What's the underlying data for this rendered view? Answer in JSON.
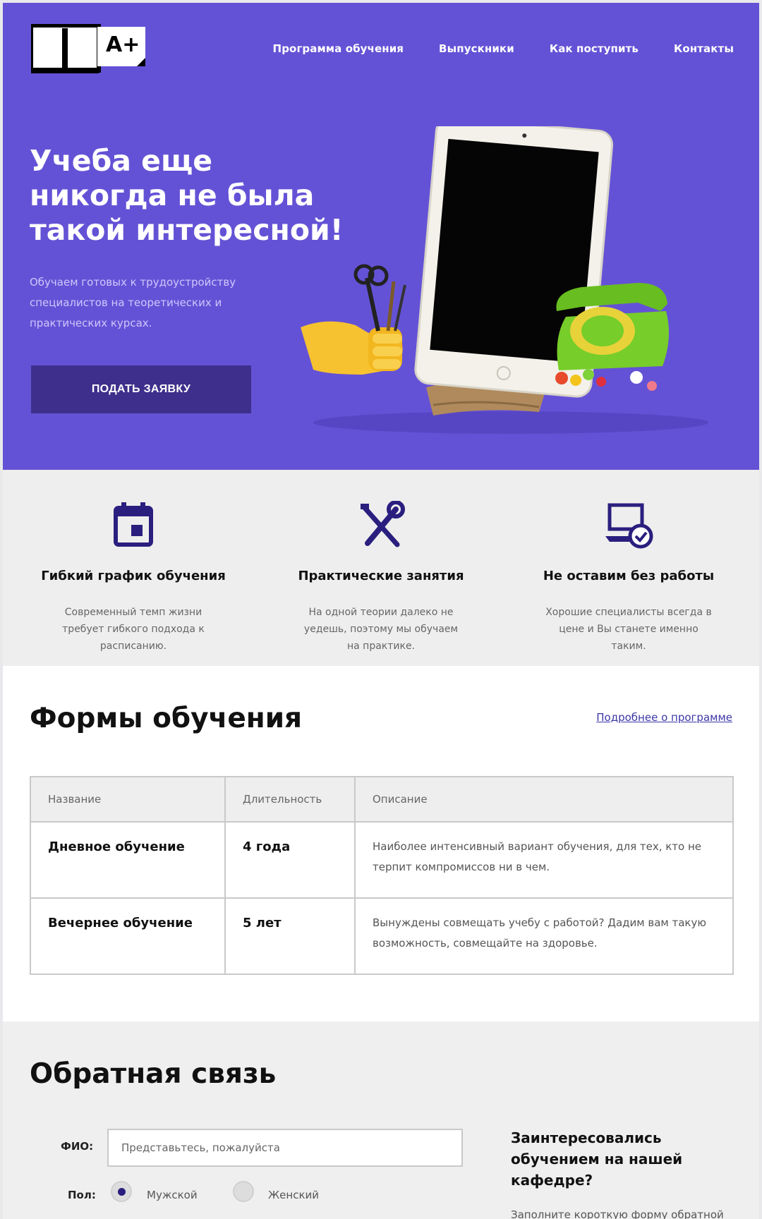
{
  "header": {
    "logo_text": "A+",
    "nav": [
      "Программа обучения",
      "Выпускники",
      "Как поступить",
      "Контакты"
    ]
  },
  "hero": {
    "title": "Учеба еще никогда не была такой интересной!",
    "subtitle": "Обучаем готовых к трудоустройству специалистов на теоретических и практических курсах.",
    "button": "ПОДАТЬ ЗАЯВКУ"
  },
  "features": [
    {
      "icon": "calendar-icon",
      "title": "Гибкий график обучения",
      "text": "Современный темп жизни требует гибкого подхода к расписанию."
    },
    {
      "icon": "tools-icon",
      "title": "Практические занятия",
      "text": "На одной теории далеко не уедешь, поэтому мы обучаем на практике."
    },
    {
      "icon": "laptop-check-icon",
      "title": "Не оставим без работы",
      "text": "Хорошие специалисты всегда в цене и Вы станете именно таким."
    }
  ],
  "forms": {
    "title": "Формы обучения",
    "more_link": "Подробнее о программе",
    "columns": [
      "Название",
      "Длительность",
      "Описание"
    ],
    "rows": [
      {
        "name": "Дневное обучение",
        "duration": "4 года",
        "description": "Наиболее интенсивный вариант обучения, для тех, кто не терпит компромиссов ни в чем."
      },
      {
        "name": "Вечернее обучение",
        "duration": "5 лет",
        "description": "Вынуждены совмещать учебу с работой? Дадим вам такую возможность, совмещайте на здоровье."
      }
    ]
  },
  "feedback": {
    "title": "Обратная связь",
    "fio_label": "ФИО:",
    "fio_placeholder": "Представьтесь, пожалуйста",
    "gender_label": "Пол:",
    "gender_options": [
      "Мужской",
      "Женский"
    ],
    "gender_selected": "Мужской",
    "side_title": "Заинтересовались обучением на нашей кафедре?",
    "side_text": "Заполните короткую форму обратной"
  },
  "colors": {
    "accent": "#6452d6",
    "button": "#3e2f8c",
    "icon": "#2a1f7e"
  }
}
